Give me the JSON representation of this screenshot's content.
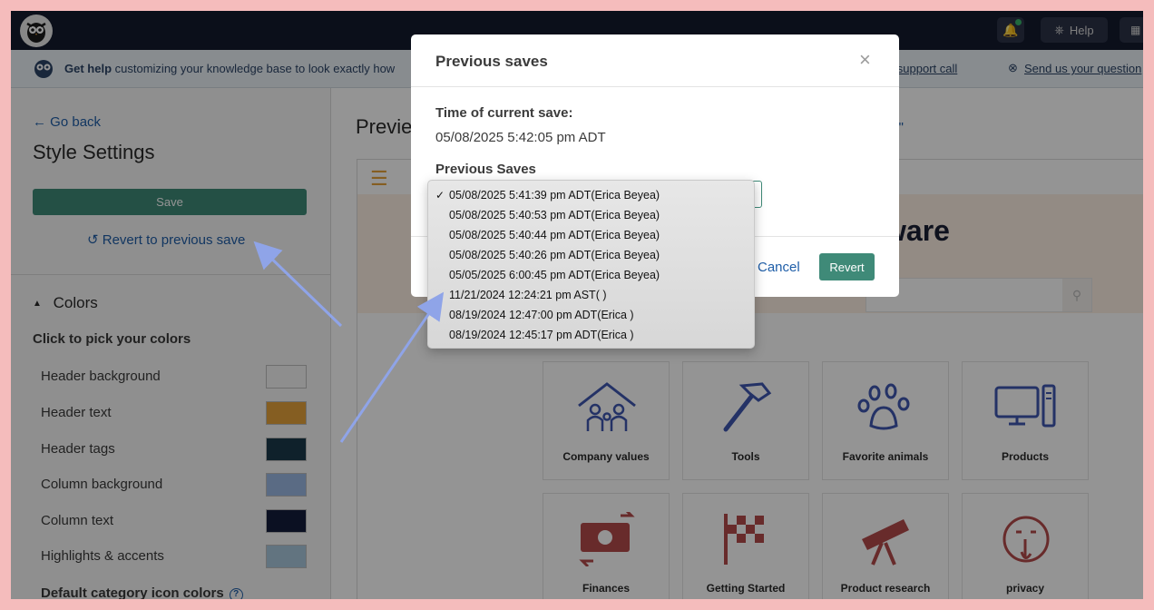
{
  "topbar": {
    "help_label": "Help"
  },
  "banner": {
    "get_help": "Get help",
    "text": "customizing your knowledge base to look exactly how",
    "schedule_link": "ule a support call",
    "send_link": "Send us your question"
  },
  "sidebar": {
    "go_back": "Go back",
    "title": "Style Settings",
    "save_label": "Save",
    "revert_label": "Revert to previous save",
    "colors_heading": "Colors",
    "pick_label": "Click to pick your colors",
    "color_rows": [
      {
        "label": "Header background",
        "color": "#f4f4f4"
      },
      {
        "label": "Header text",
        "color": "#e6a23c"
      },
      {
        "label": "Header tags",
        "color": "#1b3a4b"
      },
      {
        "label": "Column background",
        "color": "#9cb8e4"
      },
      {
        "label": "Column text",
        "color": "#131c3c"
      },
      {
        "label": "Highlights & accents",
        "color": "#a9c8dc"
      }
    ],
    "default_icons_label": "Default category icon colors"
  },
  "main": {
    "preview_title": "Previe",
    "preview_sub": "are\"",
    "hero_text": "ware",
    "tiles": [
      {
        "label": "Company values",
        "icon": "family-home-icon",
        "color": "#3e56b0"
      },
      {
        "label": "Tools",
        "icon": "hammer-icon",
        "color": "#3e56b0"
      },
      {
        "label": "Favorite animals",
        "icon": "paw-icon",
        "color": "#3e56b0"
      },
      {
        "label": "Products",
        "icon": "computer-icon",
        "color": "#3e56b0"
      },
      {
        "label": "Finances",
        "icon": "money-exchange-icon",
        "color": "#b44a4a"
      },
      {
        "label": "Getting Started",
        "icon": "checkered-flag-icon",
        "color": "#b44a4a"
      },
      {
        "label": "Product research",
        "icon": "telescope-icon",
        "color": "#b44a4a"
      },
      {
        "label": "privacy",
        "icon": "shush-face-icon",
        "color": "#b44a4a"
      }
    ]
  },
  "modal": {
    "title": "Previous saves",
    "current_label": "Time of current save:",
    "current_value": "05/08/2025 5:42:05 pm ADT",
    "previous_label": "Previous Saves",
    "cancel_label": "Cancel",
    "revert_label": "Revert"
  },
  "dropdown": {
    "selected_index": 0,
    "options": [
      "05/08/2025 5:41:39 pm ADT(Erica Beyea)",
      "05/08/2025 5:40:53 pm ADT(Erica Beyea)",
      "05/08/2025 5:40:44 pm ADT(Erica Beyea)",
      "05/08/2025 5:40:26 pm ADT(Erica Beyea)",
      "05/05/2025 6:00:45 pm ADT(Erica Beyea)",
      "11/21/2024 12:24:21 pm AST( )",
      "08/19/2024 12:47:00 pm ADT(Erica )",
      "08/19/2024 12:45:17 pm ADT(Erica )"
    ]
  },
  "colors": {
    "accent_green": "#3f8a78",
    "link_blue": "#1f5ea8",
    "annotation_arrow": "#8fa4e8"
  }
}
